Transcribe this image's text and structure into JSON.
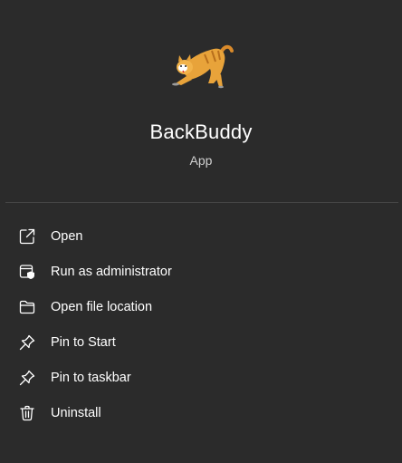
{
  "app": {
    "name": "BackBuddy",
    "type": "App",
    "icon": "stretching-cat-icon"
  },
  "menu": {
    "items": [
      {
        "label": "Open",
        "icon": "open-external-icon"
      },
      {
        "label": "Run as administrator",
        "icon": "run-as-admin-icon"
      },
      {
        "label": "Open file location",
        "icon": "folder-icon"
      },
      {
        "label": "Pin to Start",
        "icon": "pin-icon"
      },
      {
        "label": "Pin to taskbar",
        "icon": "pin-icon"
      },
      {
        "label": "Uninstall",
        "icon": "trash-icon"
      }
    ]
  },
  "colors": {
    "background": "#2b2b2b",
    "divider": "#454545",
    "text": "#ffffff",
    "subtext": "#d0d0d0",
    "cat_orange": "#e8a33a"
  }
}
